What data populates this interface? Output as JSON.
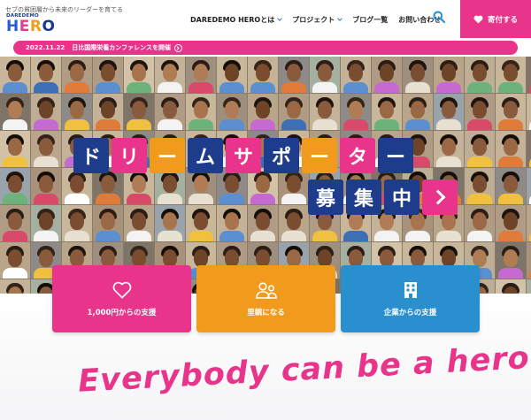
{
  "header": {
    "tagline": "セブの貧困層から未来のリーダーを育てる",
    "logo_top": "DAREDEMO",
    "logo_main": [
      "H",
      "E",
      "R",
      "O"
    ],
    "nav": [
      {
        "label": "DAREDEMO HEROとは",
        "has_dropdown": true
      },
      {
        "label": "プロジェクト",
        "has_dropdown": true
      },
      {
        "label": "ブログ一覧",
        "has_dropdown": false
      },
      {
        "label": "お問い合わせ",
        "has_dropdown": false
      }
    ],
    "donate_label": "寄付する",
    "icons": {
      "search": "search-icon",
      "donate": "heart-icon"
    }
  },
  "announcement": {
    "date": "2022.11.22",
    "text": "日比国際栄養カンファレンスを開催"
  },
  "hero": {
    "slogan_line1": [
      "ド",
      "リ",
      "ー",
      "ム",
      "サ",
      "ポ",
      "ー",
      "タ",
      "ー"
    ],
    "slogan_line2": [
      "募",
      "集",
      "中"
    ]
  },
  "cards": [
    {
      "label": "1,000円からの支援",
      "icon": "heart-outline-icon",
      "color": "#e8348a"
    },
    {
      "label": "里親になる",
      "icon": "people-icon",
      "color": "#f29a1c"
    },
    {
      "label": "企業からの支援",
      "icon": "building-icon",
      "color": "#2a8fcf"
    }
  ],
  "tagline_bottom": "Everybody can be a hero!",
  "colors": {
    "pink": "#e8348a",
    "orange": "#f29a1c",
    "navy": "#1d3d8c",
    "blue": "#2a8fcf"
  }
}
